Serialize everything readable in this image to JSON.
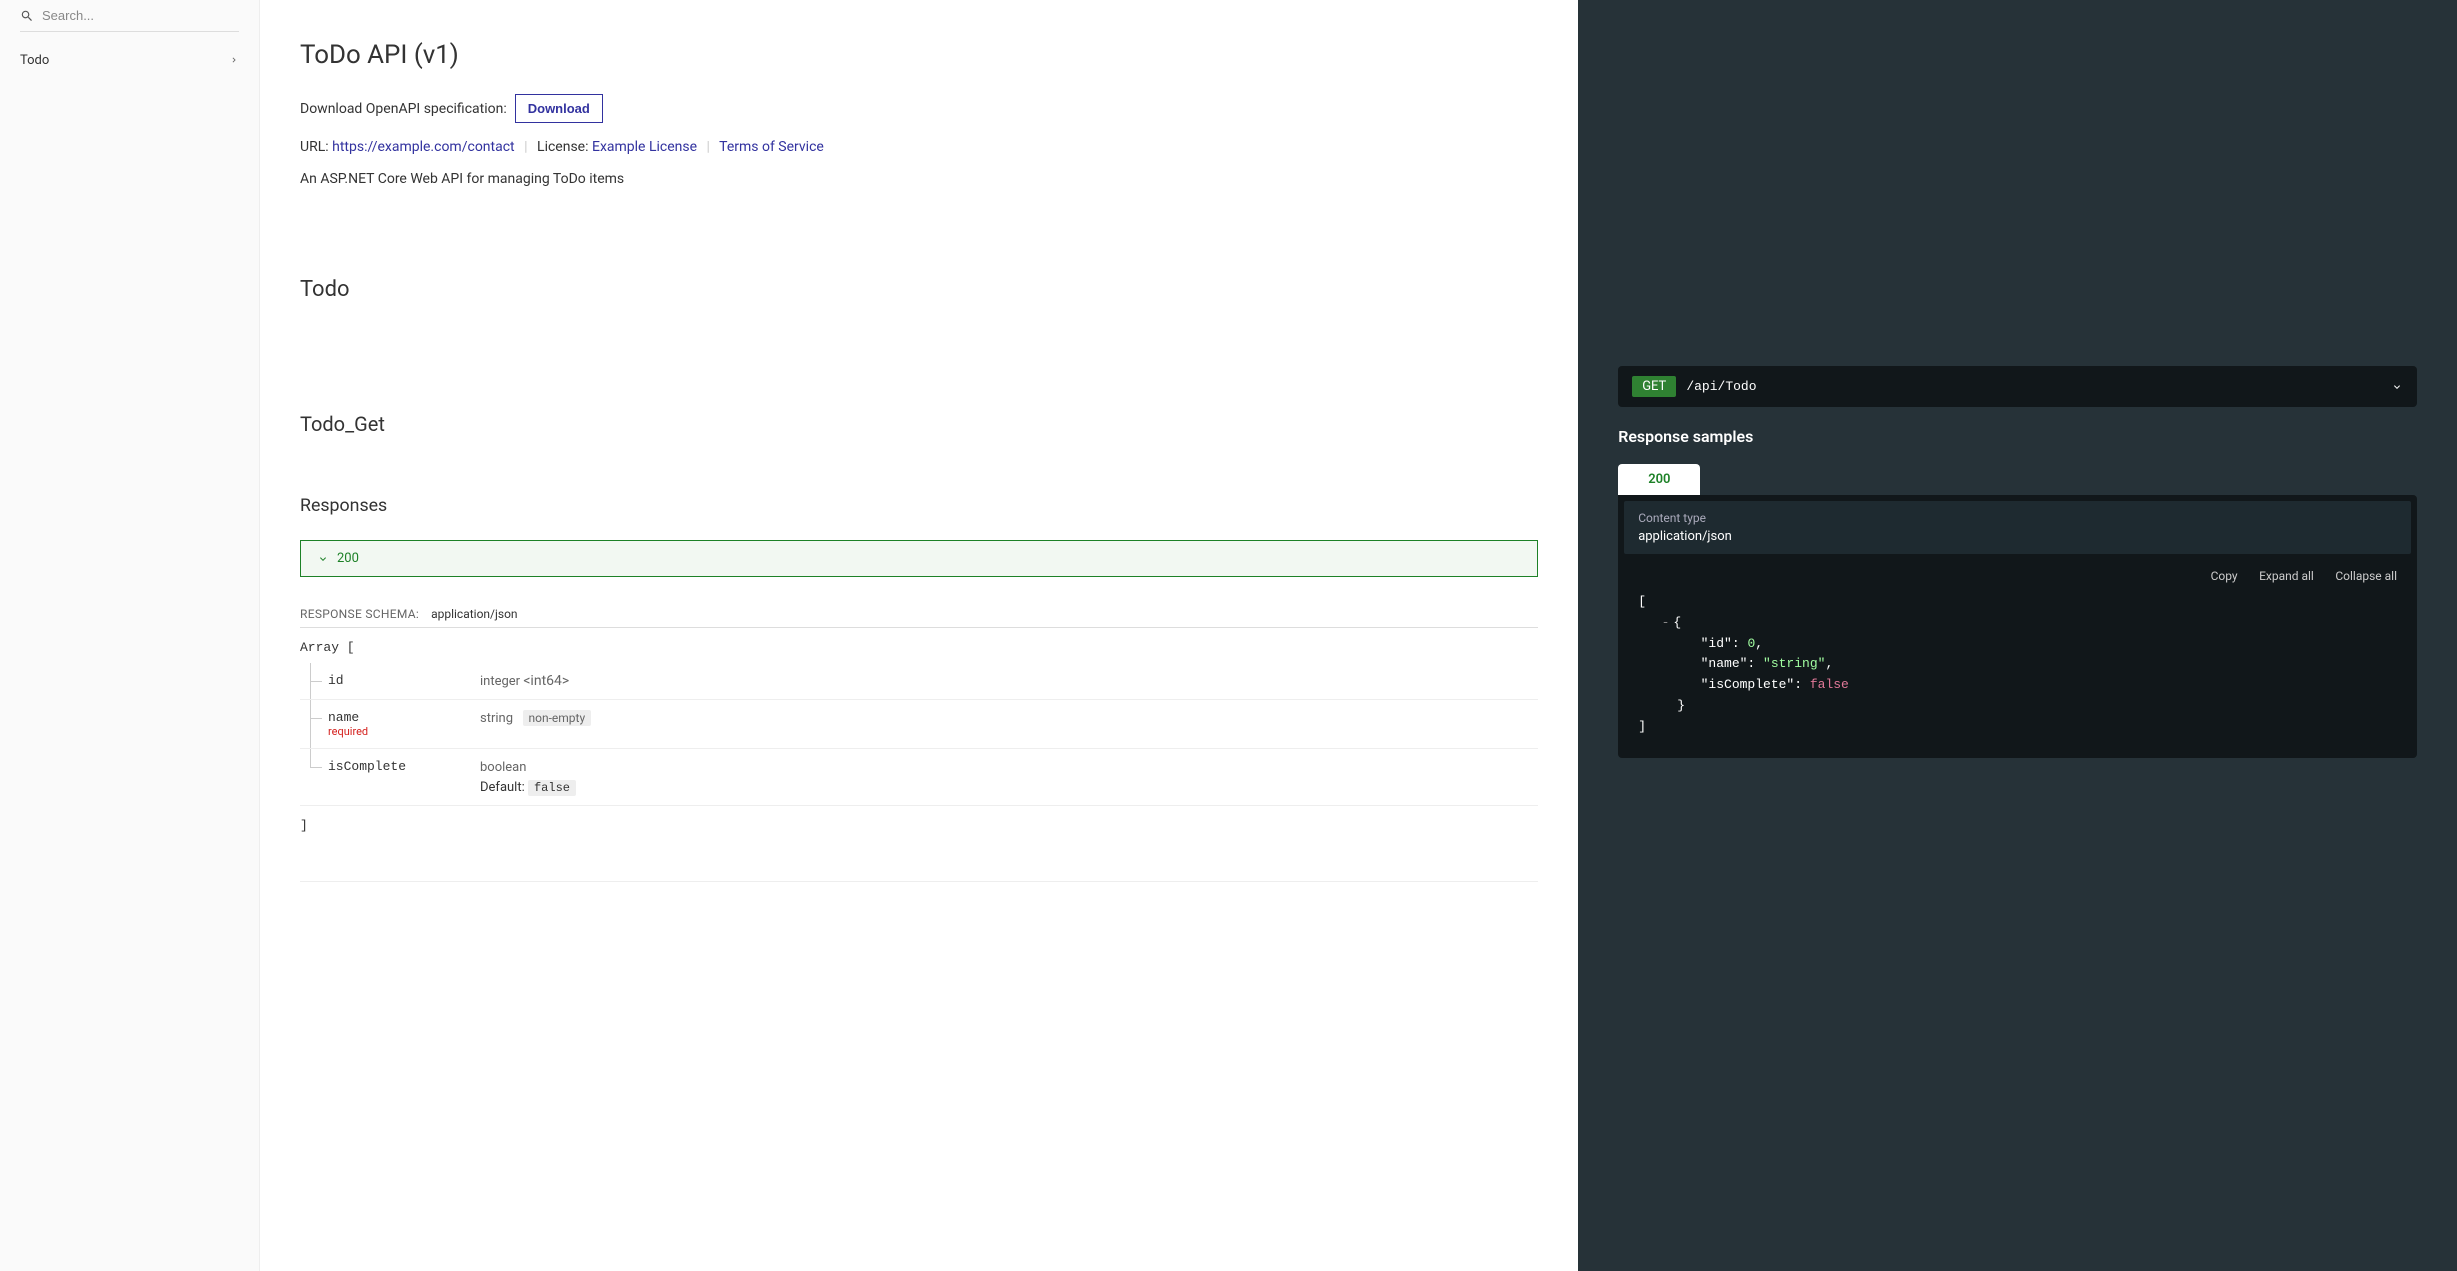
{
  "sidebar": {
    "search_placeholder": "Search...",
    "items": [
      {
        "label": "Todo"
      }
    ]
  },
  "header": {
    "title": "ToDo API (v1)",
    "spec_label": "Download OpenAPI specification:",
    "download_btn": "Download",
    "url_label": "URL: ",
    "url_link": "https://example.com/contact",
    "license_label": "License: ",
    "license_link": "Example License",
    "tos_link": "Terms of Service",
    "description": "An ASP.NET Core Web API for managing ToDo items"
  },
  "tag": {
    "name": "Todo"
  },
  "operation": {
    "name": "Todo_Get",
    "responses_heading": "Responses",
    "response_code": "200",
    "schema_label": "RESPONSE SCHEMA:",
    "schema_ct": "application/json",
    "array_open": "Array [",
    "array_close": "]",
    "props": [
      {
        "name": "id",
        "type": "integer ",
        "fmt": "<int64>",
        "required": false
      },
      {
        "name": "name",
        "type": "string",
        "badge": "non-empty",
        "required": true
      },
      {
        "name": "isComplete",
        "type": "boolean",
        "default_label": "Default: ",
        "default_val": "false",
        "required": false
      }
    ],
    "required_label": "required"
  },
  "right": {
    "method": "GET",
    "path": "/api/Todo",
    "samples_title": "Response samples",
    "tab_label": "200",
    "content_type_label": "Content type",
    "content_type_value": "application/json",
    "actions": {
      "copy": "Copy",
      "expand": "Expand all",
      "collapse": "Collapse all"
    },
    "json": {
      "l1": "[",
      "l2_collapse": "-",
      "l2": "{",
      "l3k": "\"id\"",
      "l3c": ": ",
      "l3v": "0",
      "l3e": ",",
      "l4k": "\"name\"",
      "l4c": ": ",
      "l4v": "\"string\"",
      "l4e": ",",
      "l5k": "\"isComplete\"",
      "l5c": ": ",
      "l5v": "false",
      "l6": "}",
      "l7": "]"
    }
  }
}
